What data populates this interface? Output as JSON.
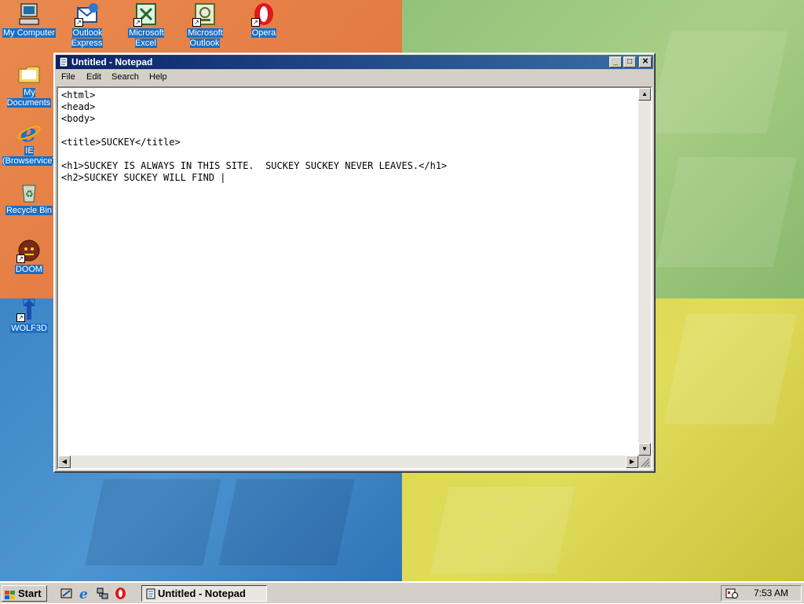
{
  "desktop": {
    "icons": [
      {
        "label": "My Computer"
      },
      {
        "label": "Outlook Express"
      },
      {
        "label": "Microsoft Excel"
      },
      {
        "label": "Microsoft Outlook"
      },
      {
        "label": "Opera"
      },
      {
        "label": "My Documents"
      },
      {
        "label": "IE (Browservice)"
      },
      {
        "label": "Recycle Bin"
      },
      {
        "label": "DOOM"
      },
      {
        "label": "WOLF3D"
      }
    ]
  },
  "notepad": {
    "title": "Untitled - Notepad",
    "menu": [
      "File",
      "Edit",
      "Search",
      "Help"
    ],
    "content": "<html>\n<head>\n<body>\n\n<title>SUCKEY</title>\n\n<h1>SUCKEY IS ALWAYS IN THIS SITE.  SUCKEY SUCKEY NEVER LEAVES.</h1>\n<h2>SUCKEY SUCKEY WILL FIND |"
  },
  "taskbar": {
    "start_label": "Start",
    "task_label": "Untitled - Notepad",
    "clock": "7:53 AM"
  },
  "colors": {
    "title_active": "#0a246a",
    "face": "#d4d0c8",
    "icon_label_bg": "#1a6fc4"
  }
}
